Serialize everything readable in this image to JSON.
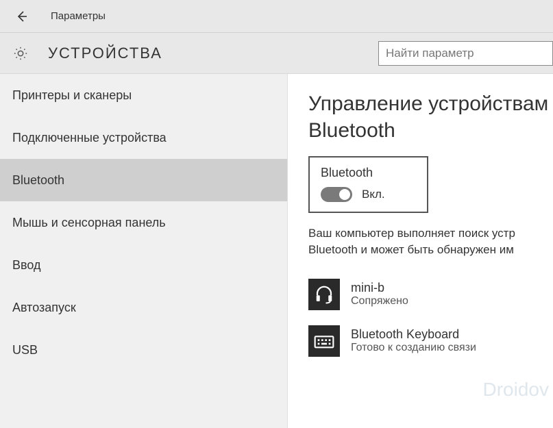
{
  "titlebar": {
    "title": "Параметры"
  },
  "header": {
    "section_title": "УСТРОЙСТВА",
    "search_placeholder": "Найти параметр"
  },
  "sidebar": {
    "items": [
      {
        "label": "Принтеры и сканеры"
      },
      {
        "label": "Подключенные устройства"
      },
      {
        "label": "Bluetooth"
      },
      {
        "label": "Мышь и сенсорная панель"
      },
      {
        "label": "Ввод"
      },
      {
        "label": "Автозапуск"
      },
      {
        "label": "USB"
      }
    ],
    "selected_index": 2
  },
  "content": {
    "heading_line1": "Управление устройствам",
    "heading_line2": "Bluetooth",
    "toggle": {
      "label": "Bluetooth",
      "state_label": "Вкл.",
      "on": true
    },
    "description_line1": "Ваш компьютер выполняет поиск устр",
    "description_line2": "Bluetooth и может быть обнаружен им",
    "devices": [
      {
        "name": "mini-b",
        "status": "Сопряжено",
        "icon": "headset"
      },
      {
        "name": "Bluetooth Keyboard",
        "status": "Готово к созданию связи",
        "icon": "keyboard"
      }
    ]
  },
  "watermark": "Droidov"
}
